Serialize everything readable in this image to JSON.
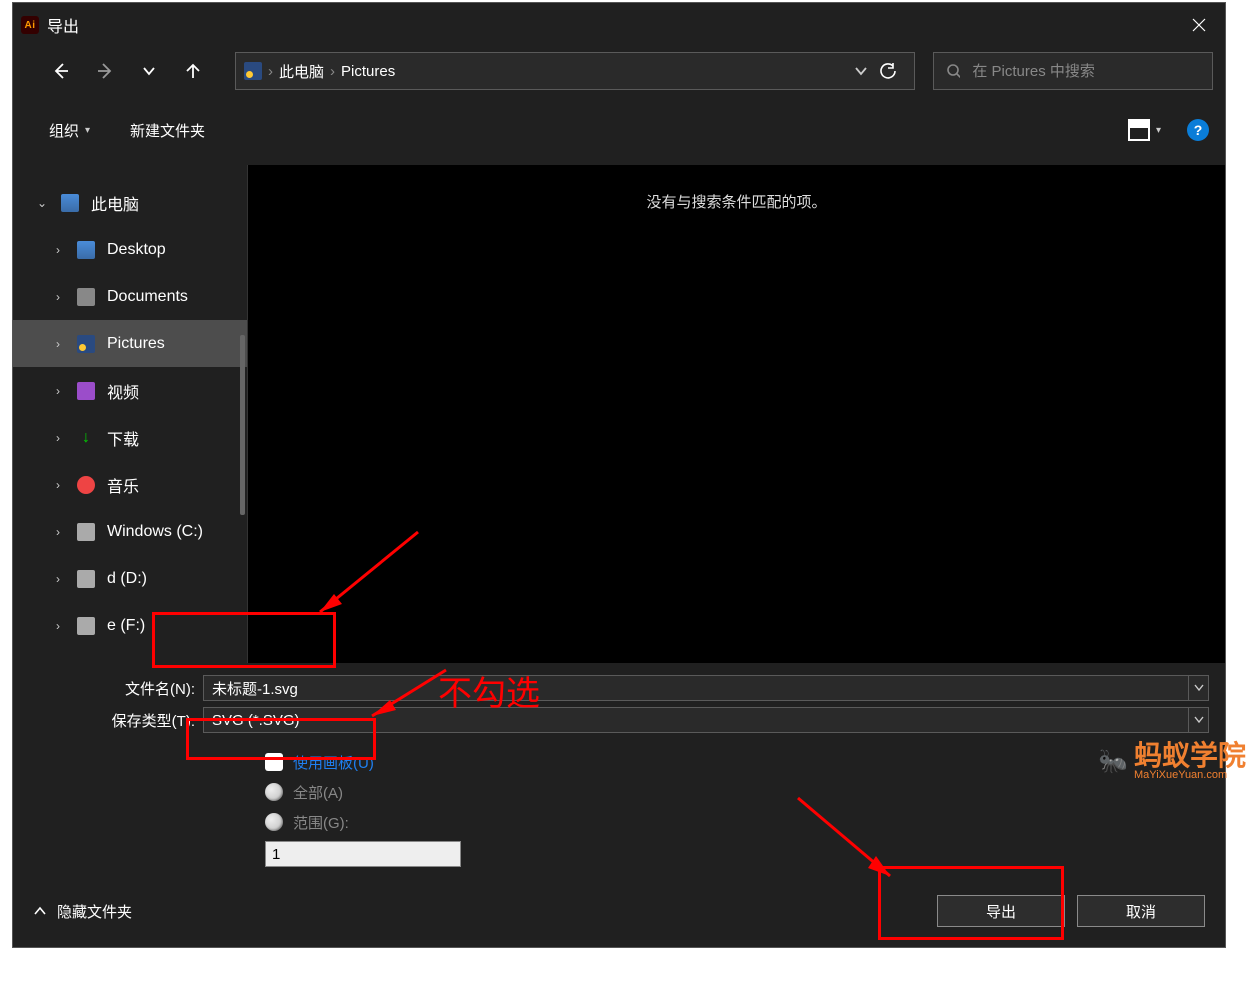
{
  "titlebar": {
    "title": "导出"
  },
  "nav": {
    "breadcrumb": {
      "item1": "此电脑",
      "item2": "Pictures"
    },
    "search_placeholder": "在 Pictures 中搜索"
  },
  "toolbar": {
    "organize": "组织",
    "new_folder": "新建文件夹"
  },
  "sidebar": {
    "root": "此电脑",
    "items": [
      {
        "label": "Desktop",
        "icon": "ic-desktop"
      },
      {
        "label": "Documents",
        "icon": "ic-docs"
      },
      {
        "label": "Pictures",
        "icon": "ic-pics",
        "selected": true
      },
      {
        "label": "视频",
        "icon": "ic-video"
      },
      {
        "label": "下载",
        "icon": "ic-dl"
      },
      {
        "label": "音乐",
        "icon": "ic-music"
      },
      {
        "label": "Windows (C:)",
        "icon": "ic-drive"
      },
      {
        "label": "d (D:)",
        "icon": "ic-drive"
      },
      {
        "label": "e (F:)",
        "icon": "ic-drive"
      }
    ]
  },
  "content": {
    "empty_text": "没有与搜索条件匹配的项。"
  },
  "form": {
    "filename_label": "文件名(N):",
    "filename_value": "未标题-1.svg",
    "filetype_label": "保存类型(T):",
    "filetype_value": "SVG (*.SVG)",
    "use_artboards": "使用画板(U)",
    "opt_all": "全部(A)",
    "opt_range": "范围(G):",
    "range_value": "1"
  },
  "footer": {
    "hide_folders": "隐藏文件夹",
    "export": "导出",
    "cancel": "取消"
  },
  "annotations": {
    "dont_check": "不勾选"
  },
  "watermark": {
    "text": "蚂蚁学院",
    "url": "MaYiXueYuan.com"
  }
}
